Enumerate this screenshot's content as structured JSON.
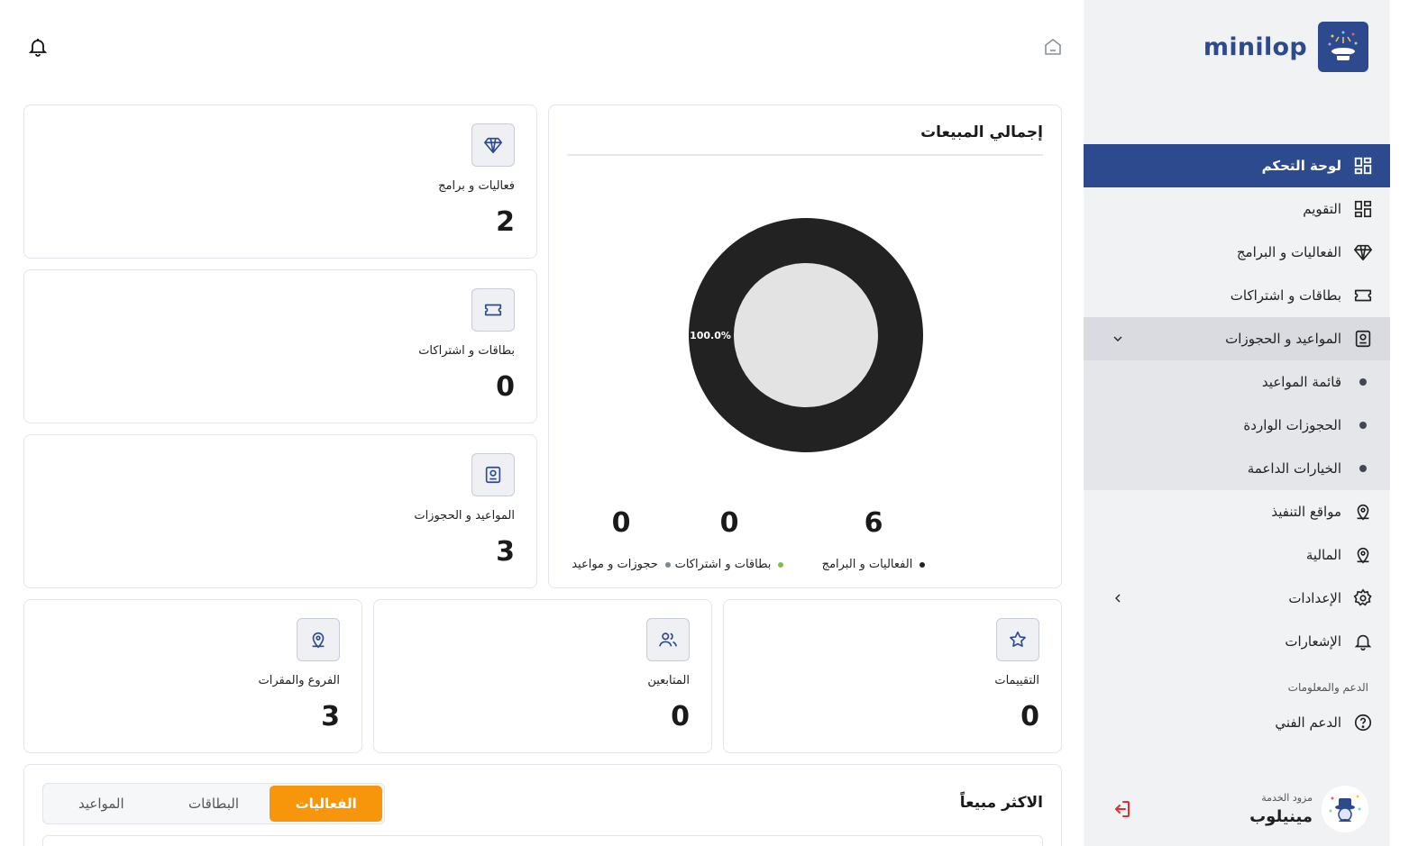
{
  "brand": {
    "name": "minilop",
    "color": "#2e4a8f"
  },
  "nav": {
    "items": [
      {
        "label": "لوحة التحكم",
        "icon": "dashboard-icon",
        "state": "active"
      },
      {
        "label": "التقويم",
        "icon": "calendar-grid-icon",
        "state": "normal"
      },
      {
        "label": "الفعاليات و البرامج",
        "icon": "diamond-icon",
        "state": "normal"
      },
      {
        "label": "بطاقات و اشتراكات",
        "icon": "ticket-icon",
        "state": "normal"
      },
      {
        "label": "المواعيد و الحجوزات",
        "icon": "booking-icon",
        "state": "open"
      }
    ],
    "sub_items": [
      {
        "label": "قائمة المواعيد"
      },
      {
        "label": "الحجوزات الواردة"
      },
      {
        "label": "الخيارات الداعمة"
      }
    ],
    "items_after": [
      {
        "label": "مواقع التنفيذ",
        "icon": "location-icon"
      },
      {
        "label": "المالية",
        "icon": "location-icon"
      },
      {
        "label": "الإعدادات",
        "icon": "gear-icon"
      },
      {
        "label": "الإشعارات",
        "icon": "bell-icon"
      }
    ],
    "support_section": "الدعم والمعلومات",
    "support_item": {
      "label": "الدعم الفني",
      "icon": "help-icon"
    }
  },
  "profile": {
    "role": "مزود الخدمة",
    "name": "مينيلوب"
  },
  "stats_top": [
    {
      "label": "فعاليات و برامج",
      "value": "2",
      "icon": "diamond-icon"
    },
    {
      "label": "بطاقات و اشتراكات",
      "value": "0",
      "icon": "ticket-icon"
    },
    {
      "label": "المواعيد و الحجوزات",
      "value": "3",
      "icon": "booking-icon"
    }
  ],
  "stats_bottom": [
    {
      "label": "التقييمات",
      "value": "0",
      "icon": "star-icon"
    },
    {
      "label": "المتابعين",
      "value": "0",
      "icon": "users-icon"
    },
    {
      "label": "الفروع والمقرات",
      "value": "3",
      "icon": "location-icon"
    }
  ],
  "sales": {
    "title": "إجمالي المبيعات",
    "legend": [
      {
        "label": "الفعاليات و البرامج",
        "value": "6",
        "color": "#222222"
      },
      {
        "label": "بطاقات و اشتراكات",
        "value": "0",
        "color": "#7cc04b"
      },
      {
        "label": "حجوزات و مواعيد",
        "value": "0",
        "color": "#7d8793"
      }
    ]
  },
  "chart_data": {
    "type": "pie",
    "categories": [
      "الفعاليات و البرامج",
      "بطاقات و اشتراكات",
      "حجوزات و مواعيد"
    ],
    "values": [
      6,
      0,
      0
    ],
    "slice_labels": [
      "100.0%"
    ],
    "colors": [
      "#222222",
      "#7cc04b",
      "#7d8793"
    ],
    "donut": true
  },
  "best_selling": {
    "title": "الاكثر مبيعاً",
    "tabs": [
      {
        "label": "الفعاليات",
        "active": true
      },
      {
        "label": "البطاقات",
        "active": false
      },
      {
        "label": "المواعيد",
        "active": false
      }
    ]
  }
}
